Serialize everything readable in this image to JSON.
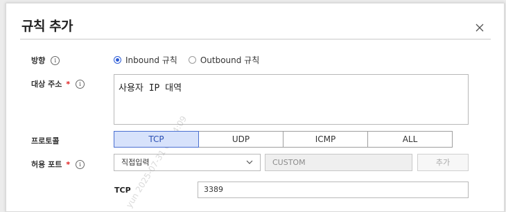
{
  "dialog": {
    "title": "규칙 추가",
    "close_icon": "close-icon"
  },
  "direction": {
    "label": "방향",
    "options": [
      "Inbound 규칙",
      "Outbound 규칙"
    ],
    "selected": "Inbound 규칙"
  },
  "target": {
    "label": "대상 주소",
    "required_mark": "*",
    "value": "사용자 IP 대역"
  },
  "protocol": {
    "label": "프로토콜",
    "options": [
      "TCP",
      "UDP",
      "ICMP",
      "ALL"
    ],
    "selected": "TCP"
  },
  "port": {
    "label": "허용 포트",
    "required_mark": "*",
    "select_value": "직접입력",
    "custom_value": "CUSTOM",
    "add_button": "추가",
    "protocol_label": "TCP",
    "port_value": "3389"
  },
  "info_glyph": "i",
  "watermark": "yun 2025-07-31 09:14:09",
  "colors": {
    "accent": "#2c5bd6",
    "selected_bg": "#d7e2fb",
    "required": "#e02020"
  }
}
